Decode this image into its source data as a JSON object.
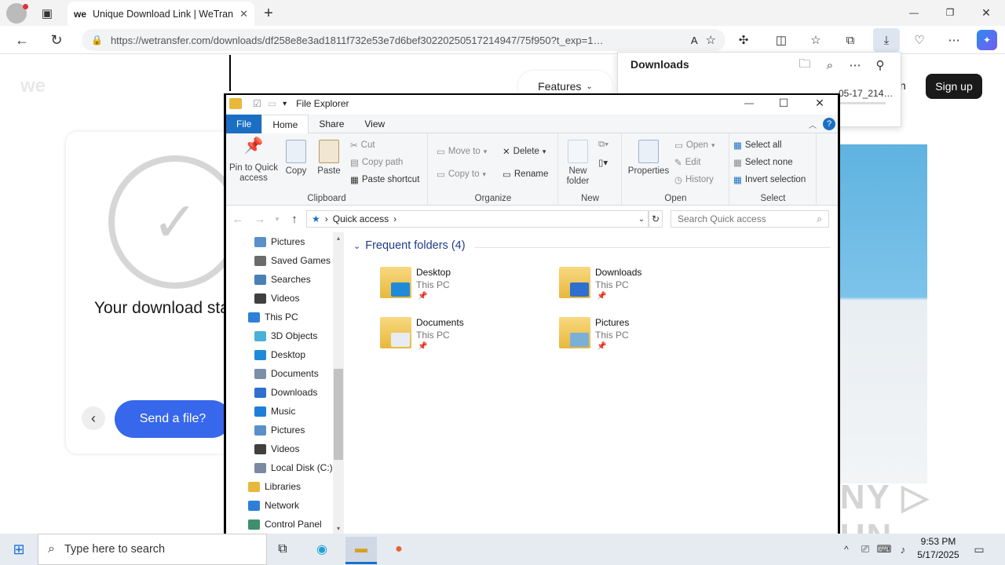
{
  "browser": {
    "tab_title": "Unique Download Link | WeTransfer",
    "favicon_text": "we",
    "url": "https://wetransfer.com/downloads/df258e8e3ad1811f732e53e7d6bef30220250517214947/75f950?t_exp=1…",
    "url_host": "wetransfer.com",
    "new_tab": "+",
    "min": "—",
    "restore": "❐",
    "close": "✕"
  },
  "downloads_panel": {
    "title": "Downloads",
    "item_text": "05-17_214…",
    "sign_in_partial": "n"
  },
  "page": {
    "logo": "we",
    "features_label": "Features",
    "sign_up": "Sign up",
    "download_title": "Your download started",
    "send_label": "Send a file?",
    "watermark": "ANY ▷ RUN"
  },
  "explorer": {
    "title": "File Explorer",
    "tabs": [
      "File",
      "Home",
      "Share",
      "View"
    ],
    "ribbon": {
      "clipboard": {
        "label": "Clipboard",
        "pin": "Pin to Quick access",
        "copy": "Copy",
        "paste": "Paste",
        "cut": "Cut",
        "copy_path": "Copy path",
        "paste_shortcut": "Paste shortcut"
      },
      "organize": {
        "label": "Organize",
        "move_to": "Move to",
        "copy_to": "Copy to",
        "delete": "Delete",
        "rename": "Rename"
      },
      "new": {
        "label": "New",
        "new_folder": "New folder"
      },
      "open": {
        "label": "Open",
        "properties": "Properties",
        "open": "Open",
        "edit": "Edit",
        "history": "History"
      },
      "select": {
        "label": "Select",
        "select_all": "Select all",
        "select_none": "Select none",
        "invert": "Invert selection"
      }
    },
    "breadcrumb": "Quick access",
    "search_placeholder": "Search Quick access",
    "nav_items": [
      {
        "label": "Pictures",
        "color": "#5a8fc9"
      },
      {
        "label": "Saved Games",
        "color": "#6b6b6b"
      },
      {
        "label": "Searches",
        "color": "#4a7fb8"
      },
      {
        "label": "Videos",
        "color": "#404040"
      },
      {
        "label": "This PC",
        "color": "#2f7fd8"
      },
      {
        "label": "3D Objects",
        "color": "#4ab0d8"
      },
      {
        "label": "Desktop",
        "color": "#1f8ad8"
      },
      {
        "label": "Documents",
        "color": "#7a8fa8"
      },
      {
        "label": "Downloads",
        "color": "#2f6fd0"
      },
      {
        "label": "Music",
        "color": "#1f7fd8"
      },
      {
        "label": "Pictures",
        "color": "#5a8fc9"
      },
      {
        "label": "Videos",
        "color": "#404040"
      },
      {
        "label": "Local Disk (C:)",
        "color": "#7a8aa0"
      },
      {
        "label": "Libraries",
        "color": "#e8b83c"
      },
      {
        "label": "Network",
        "color": "#2f7fd8"
      },
      {
        "label": "Control Panel",
        "color": "#3f8f6f"
      }
    ],
    "frequent_header": "Frequent folders (4)",
    "folders": [
      {
        "name": "Desktop",
        "sub": "This PC",
        "overlay": "#1f8ad8"
      },
      {
        "name": "Downloads",
        "sub": "This PC",
        "overlay": "#2f6fd0"
      },
      {
        "name": "Documents",
        "sub": "This PC",
        "overlay": "#e8ecf2"
      },
      {
        "name": "Pictures",
        "sub": "This PC",
        "overlay": "#7ab0d8"
      }
    ],
    "min": "—",
    "max": "☐",
    "close": "✕"
  },
  "taskbar": {
    "search_placeholder": "Type here to search",
    "time": "9:53 PM",
    "date": "5/17/2025"
  }
}
